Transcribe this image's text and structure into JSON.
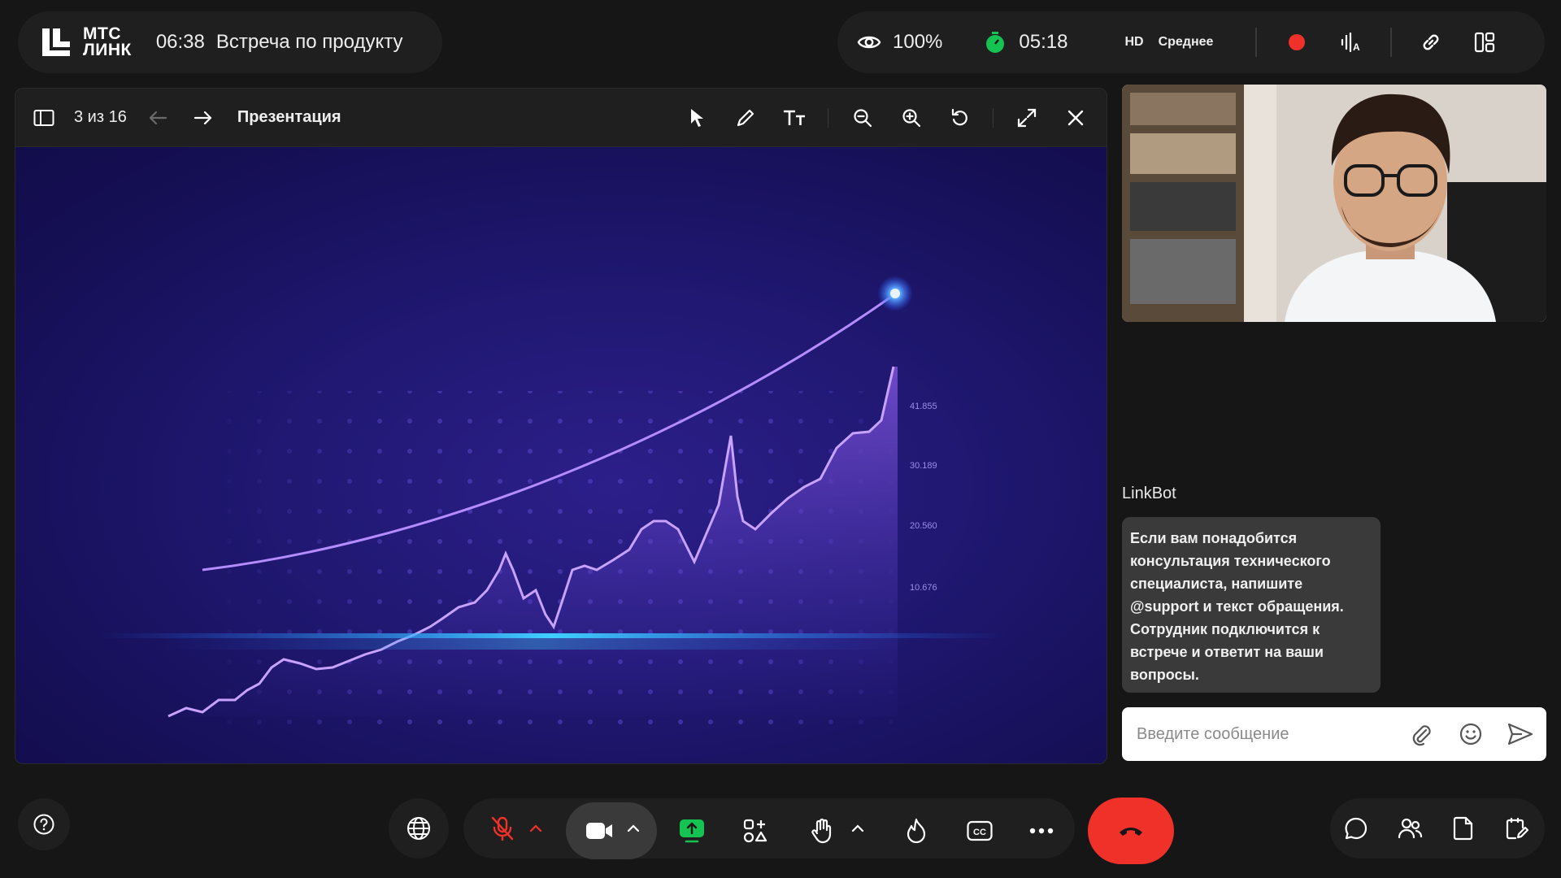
{
  "header": {
    "brand_line1": "МТС",
    "brand_line2": "ЛИНК",
    "time": "06:38",
    "title": "Встреча по продукту",
    "viewers": "100%",
    "timer": "05:18",
    "quality": "HD",
    "quality_level": "Среднее"
  },
  "presentation": {
    "page": "3 из 16",
    "title": "Презентация",
    "slide_labels": [
      "41.855",
      "30.189",
      "20.560",
      "10.676"
    ]
  },
  "chat": {
    "bot_name": "LinkBot",
    "bot_message": "Если вам понадобится консультация технического специалиста, напишите @support и текст обращения. Сотрудник подключится к встрече и ответит на ваши вопросы.",
    "input_placeholder": "Введите сообщение"
  },
  "colors": {
    "record": "#f0312a",
    "hangup": "#f0312a",
    "green": "#14c351",
    "mic_off": "#f0312a"
  }
}
